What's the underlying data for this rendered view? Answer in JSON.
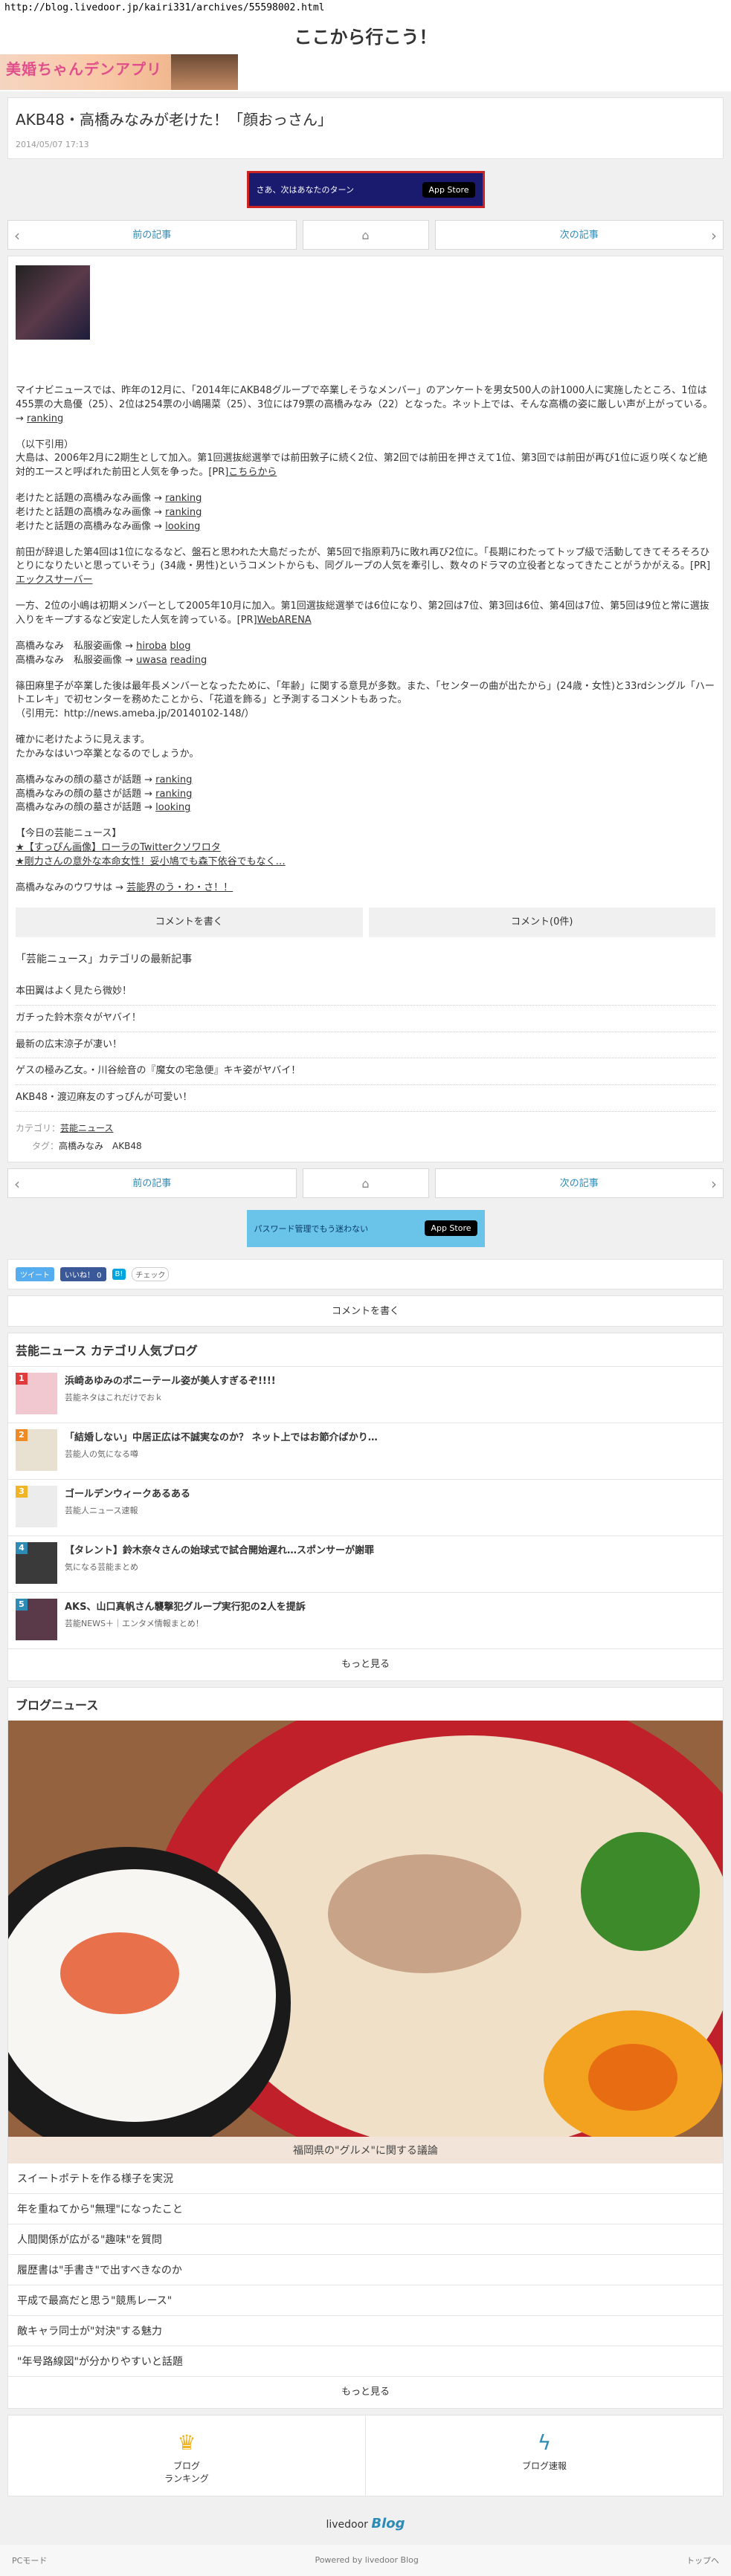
{
  "url": "http://blog.livedoor.jp/kairi331/archives/55598002.html",
  "site_title": "ここから行こう！",
  "banner_text": "美婚ちゃんデンアプリ",
  "article": {
    "title": "AKB48・高橋みなみが老けた！「顔おっさん」",
    "date": "2014/05/07 17:13"
  },
  "ad1": {
    "text": "さあ、次はあなたのターン",
    "store": "App Store"
  },
  "pager": {
    "prev": "前の記事",
    "next": "次の記事"
  },
  "body": {
    "p1": "マイナビニュースでは、昨年の12月に、「2014年にAKB48グループで卒業しそうなメンバー」のアンケートを男女500人の計1000人に実施したところ、1位は455票の大島優（25）、2位は254票の小嶋陽菜（25）、3位には79票の高橋みなみ（22）となった。ネット上では、そんな高橋の姿に厳しい声が上がっている。→",
    "p1_link": "ranking",
    "p2_quote": "（以下引用）",
    "p2": "大島は、2006年2月に2期生として加入。第1回選抜総選挙では前田敦子に続く2位、第2回では前田を押さえて1位、第3回では前田が再び1位に返り咲くなど絶対的エースと呼ばれた前田と人気を争った。[PR]",
    "p2_link": "こちらから",
    "links_a": [
      {
        "text": "老けたと話題の高橋みなみ画像 →",
        "link": "ranking"
      },
      {
        "text": "老けたと話題の高橋みなみ画像 →",
        "link": "ranking"
      },
      {
        "text": "老けたと話題の高橋みなみ画像 →",
        "link": "looking"
      }
    ],
    "p3": "前田が辞退した第4回は1位になるなど、盤石と思われた大島だったが、第5回で指原莉乃に敗れ再び2位に。「長期にわたってトップ級で活動してきてそろそろひとりになりたいと思っていそう」(34歳・男性)というコメントからも、同グループの人気を牽引し、数々のドラマの立役者となってきたことがうかがえる。[PR]",
    "p3_link": "エックスサーバー",
    "p4": "一方、2位の小嶋は初期メンバーとして2005年10月に加入。第1回選抜総選挙では6位になり、第2回は7位、第3回は6位、第4回は7位、第5回は9位と常に選抜入りをキープするなど安定した人気を誇っている。[PR]",
    "p4_link": "WebARENA",
    "links_b": [
      {
        "text": "高橋みなみ　私服姿画像 →",
        "link1": "hiroba",
        "link2": "blog"
      },
      {
        "text": "高橋みなみ　私服姿画像 →",
        "link1": "uwasa",
        "link2": "reading"
      }
    ],
    "p5": "篠田麻里子が卒業した後は最年長メンバーとなったために、「年齢」に関する意見が多数。また、「センターの曲が出たから」(24歳・女性)と33rdシングル「ハートエレキ」で初センターを務めたことから、「花道を飾る」と予測するコメントもあった。",
    "p5_cite": "（引用元：http://news.ameba.jp/20140102-148/）",
    "p6a": "確かに老けたように見えます。",
    "p6b": "たかみなはいつ卒業となるのでしょうか。",
    "links_c": [
      {
        "text": "高橋みなみの顔の墓さが話題 →",
        "link": "ranking"
      },
      {
        "text": "高橋みなみの顔の墓さが話題 →",
        "link": "ranking"
      },
      {
        "text": "高橋みなみの顔の墓さが話題 →",
        "link": "looking"
      }
    ],
    "today_head": "【今日の芸能ニュース】",
    "today_1": "★【すっぴん画像】ローラのTwitterクソワロタ",
    "today_2": "★剛力さんの意外な本命女性！妥小鳩でも森下依谷でもなく…",
    "rumor_prefix": "高橋みなみのウワサは →",
    "rumor_link": "芸能界のう・わ・さ！！"
  },
  "comment_buttons": {
    "write": "コメントを書く",
    "count": "コメント(0件)"
  },
  "category": {
    "heading": "「芸能ニュース」カテゴリの最新記事",
    "items": [
      "本田翼はよく見たら微妙！",
      "ガチった鈴木奈々がヤバイ！",
      "最新の広末涼子が凄い！",
      "ゲスの極み乙女。・川谷絵音の『魔女の宅急便』キキ姿がヤバイ！",
      "AKB48・渡辺麻友のすっぴんが可愛い！"
    ],
    "meta_cat_label": "カテゴリ：",
    "meta_cat": "芸能ニュース",
    "meta_tag_label": "タグ：",
    "meta_tags": "高橋みなみ　AKB48"
  },
  "ad2": {
    "text": "パスワード管理でもう迷わない",
    "store": "App Store"
  },
  "social": {
    "tweet": "ツイート",
    "like": "いいね！ 0",
    "hatena": "B!",
    "check": "チェック"
  },
  "comment_write": "コメントを書く",
  "popular": {
    "title": "芸能ニュース カテゴリ人気ブログ",
    "items": [
      {
        "rank": "1",
        "title": "浜崎あゆみのポニーテール姿が美人すぎるぞ!!!!",
        "blog": "芸能ネタはこれだけでおｋ",
        "color": "#e03b3b"
      },
      {
        "rank": "2",
        "title": "「結婚しない」中居正広は不誠実なのか？ ネット上ではお節介ばかり…",
        "blog": "芸能人の気になる噂",
        "color": "#f08a24"
      },
      {
        "rank": "3",
        "title": "ゴールデンウィークあるある",
        "blog": "芸能人ニュース速報",
        "color": "#f0b424"
      },
      {
        "rank": "4",
        "title": "【タレント】鈴木奈々さんの始球式で試合開始遅れ…スポンサーが謝罪",
        "blog": "気になる芸能まとめ",
        "color": "#2d8bb5"
      },
      {
        "rank": "5",
        "title": "AKS、山口真帆さん襲撃犯グループ実行犯の2人を提訴",
        "blog": "芸能NEWS＋｜エンタメ情報まとめ！",
        "color": "#2d8bb5"
      }
    ],
    "more": "もっと見る"
  },
  "blognews": {
    "title": "ブログニュース",
    "caption": "福岡県の\"グルメ\"に関する議論",
    "items": [
      "スイートポテトを作る様子を実況",
      "年を重ねてから\"無理\"になったこと",
      "人間関係が広がる\"趣味\"を質問",
      "履歴書は\"手書き\"で出すべきなのか",
      "平成で最高だと思う\"競馬レース\"",
      "敵キャラ同士が\"対決\"する魅力",
      "\"年号路線図\"が分かりやすいと話題"
    ],
    "more": "もっと見る"
  },
  "footer": {
    "ranking": "ブログ\nランキング",
    "news": "ブログ速報",
    "logo_ld": "livedoor",
    "logo_blog": "Blog",
    "pc_mode": "PCモード",
    "powered": "Powered by livedoor Blog",
    "top": "トップへ"
  }
}
